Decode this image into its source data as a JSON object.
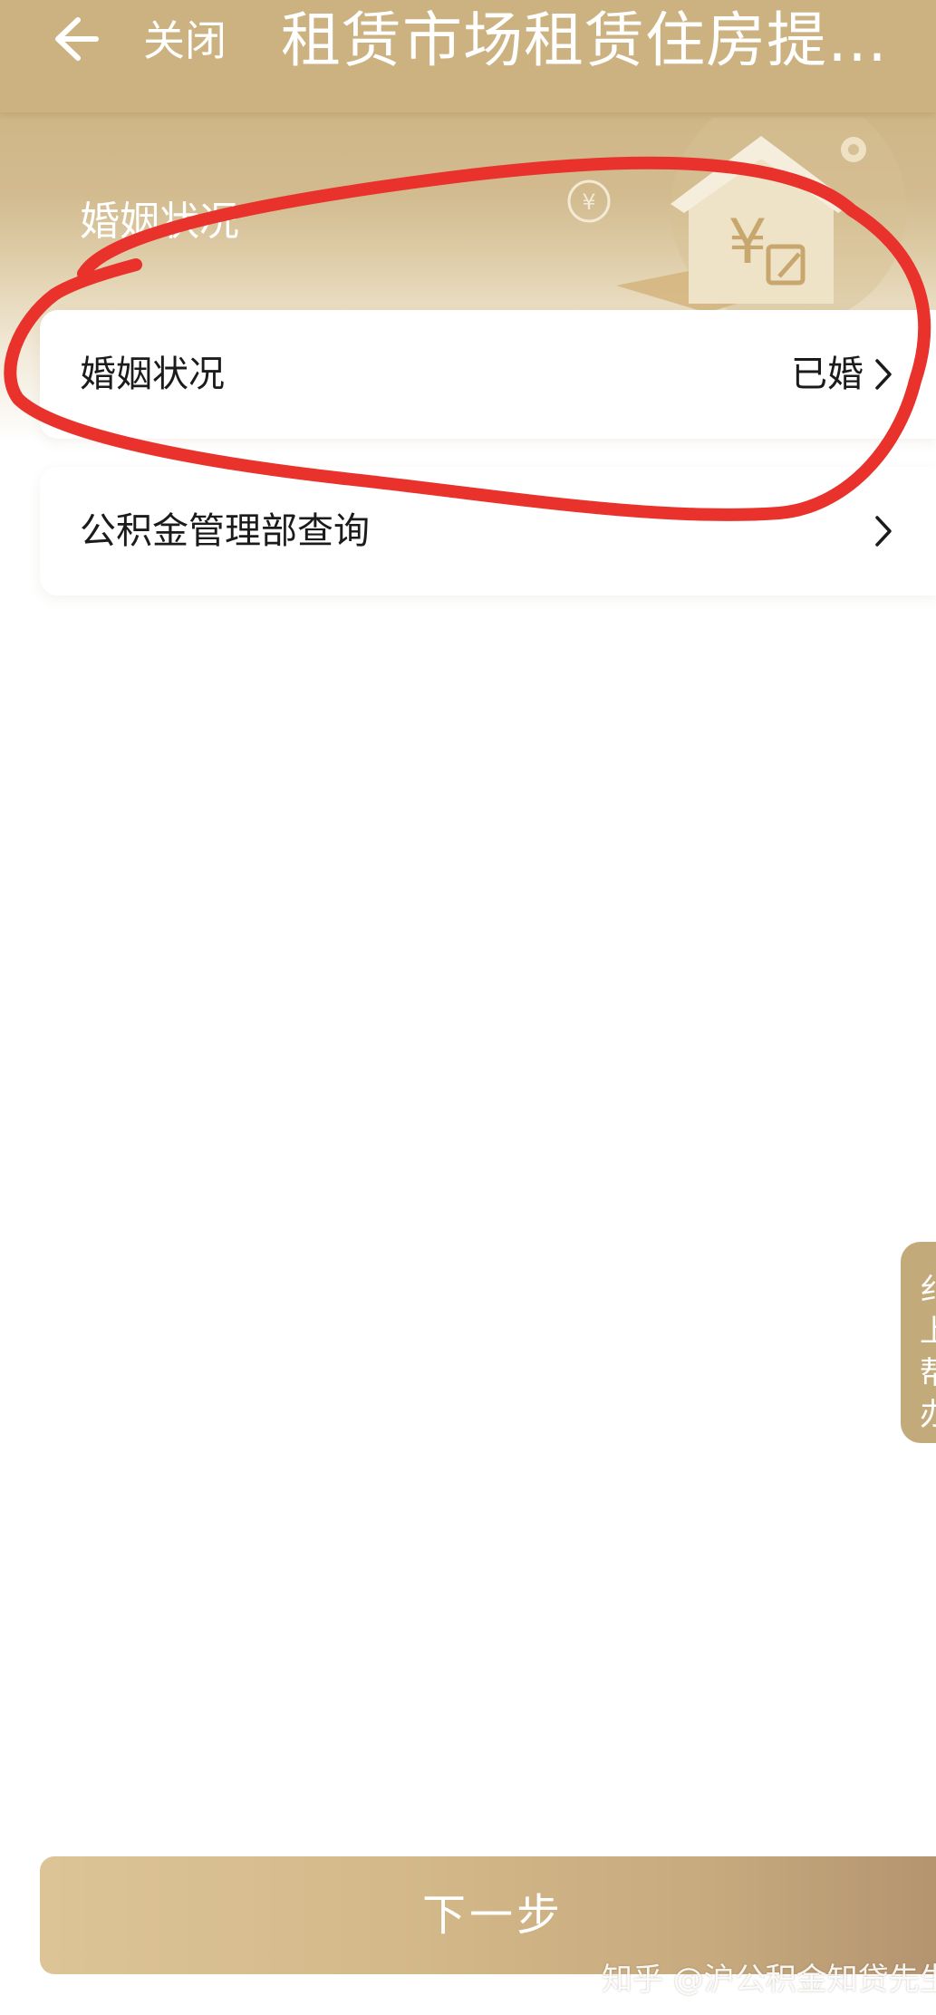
{
  "nav": {
    "back_icon": "arrow-left-icon",
    "close_label": "关闭",
    "title": "租赁市场租赁住房提…"
  },
  "section": {
    "title": "婚姻状况"
  },
  "form": {
    "rows": [
      {
        "label": "婚姻状况",
        "value": "已婚",
        "icon": "chevron-right-icon"
      },
      {
        "label": "公积金管理部查询",
        "value": "",
        "icon": "chevron-right-icon"
      }
    ]
  },
  "float_tab": {
    "text": "纟上帮办"
  },
  "footer": {
    "next_label": "下一步"
  },
  "watermark": {
    "text": "知乎 @沪公积金知贷先生"
  },
  "colors": {
    "header_gold": "#cbb280",
    "button_start": "#dcc497",
    "button_end": "#b4946f",
    "annotation_red": "#e8322b"
  }
}
